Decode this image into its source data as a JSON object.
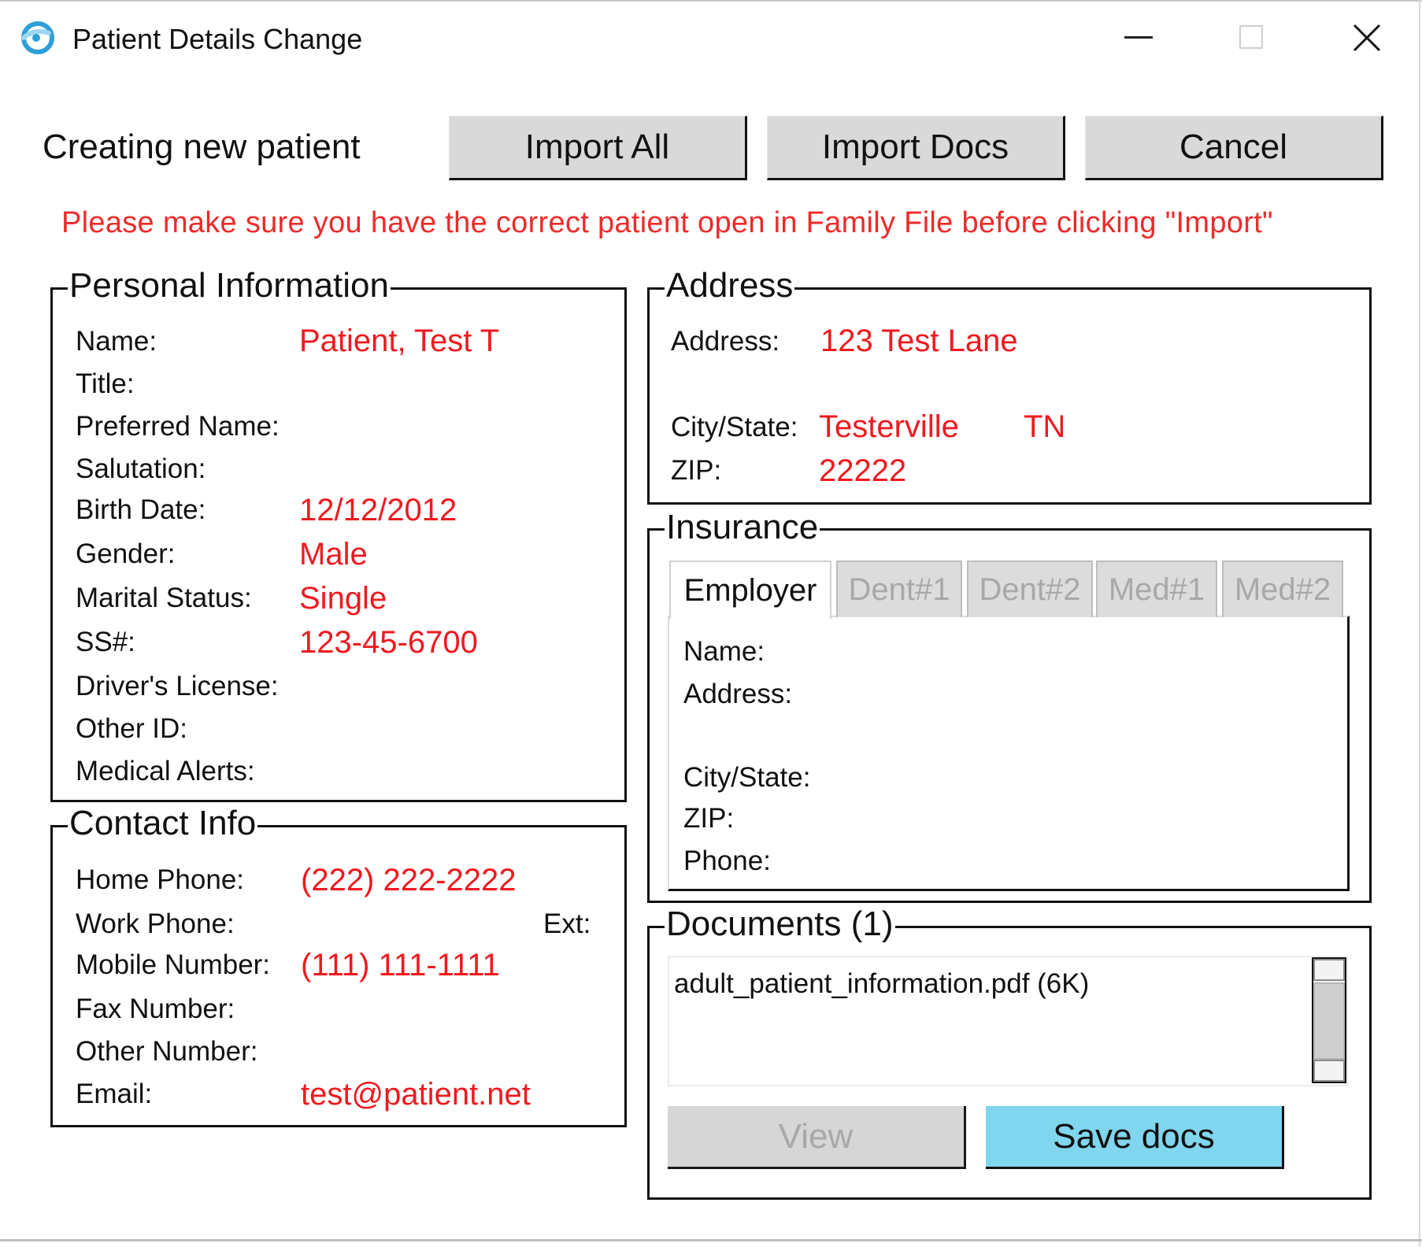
{
  "window": {
    "title": "Patient Details Change",
    "icon": "app-logo-icon",
    "controls": {
      "minimize": "—",
      "maximize": "☐",
      "close": "✕"
    }
  },
  "toolbar": {
    "status": "Creating new patient",
    "import_all": "Import All",
    "import_docs": "Import Docs",
    "cancel": "Cancel"
  },
  "warning": "Please make sure you have the correct patient open in Family File before clicking \"Import\"",
  "personal": {
    "legend": "Personal Information",
    "name_label": "Name:",
    "name_value": "Patient, Test T",
    "title_label": "Title:",
    "preferred_label": "Preferred Name:",
    "salutation_label": "Salutation:",
    "birth_label": "Birth Date:",
    "birth_value": "12/12/2012",
    "gender_label": "Gender:",
    "gender_value": "Male",
    "marital_label": "Marital Status:",
    "marital_value": "Single",
    "ss_label": "SS#:",
    "ss_value": "123-45-6700",
    "license_label": "Driver's License:",
    "other_id_label": "Other ID:",
    "alerts_label": "Medical Alerts:"
  },
  "contact": {
    "legend": "Contact Info",
    "home_label": "Home Phone:",
    "home_value": "(222) 222-2222",
    "work_label": "Work Phone:",
    "ext_label": "Ext:",
    "mobile_label": "Mobile Number:",
    "mobile_value": "(111) 111-1111",
    "fax_label": "Fax Number:",
    "other_label": "Other Number:",
    "email_label": "Email:",
    "email_value": "test@patient.net"
  },
  "address": {
    "legend": "Address",
    "address_label": "Address:",
    "address_value": "123 Test Lane",
    "city_label": "City/State:",
    "city_value": "Testerville",
    "state_value": "TN",
    "zip_label": "ZIP:",
    "zip_value": "22222"
  },
  "insurance": {
    "legend": "Insurance",
    "tabs": [
      "Employer",
      "Dent#1",
      "Dent#2",
      "Med#1",
      "Med#2"
    ],
    "name_label": "Name:",
    "address_label": "Address:",
    "city_label": "City/State:",
    "zip_label": "ZIP:",
    "phone_label": "Phone:"
  },
  "documents": {
    "legend": "Documents (1)",
    "items": [
      "adult_patient_information.pdf (6K)"
    ],
    "view": "View",
    "save": "Save docs"
  },
  "colors": {
    "value_red": "#f0191f",
    "accent_button": "#7fd6ee"
  }
}
